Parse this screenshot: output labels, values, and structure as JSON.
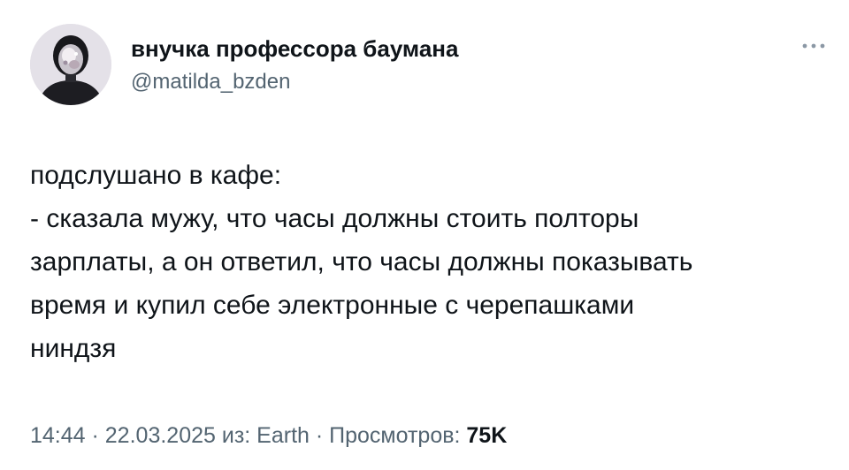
{
  "author": {
    "name": "внучка профессора баумана",
    "handle": "@matilda_bzden"
  },
  "icons": {
    "avatar": "profile-avatar",
    "more": "more-options-icon"
  },
  "tweet": {
    "lines": [
      "подслушано в кафе:",
      "- сказала мужу, что часы должны стоить полторы",
      "зарплаты, а он ответил, что часы должны показывать",
      "время и купил себе электронные с черепашками",
      "ниндзя"
    ]
  },
  "meta": {
    "time": "14:44",
    "separator1": " · ",
    "date": "22.03.2025",
    "source": " из: Earth",
    "separator2": " · ",
    "views_label": "Просмотров: ",
    "views_count": "75K"
  },
  "colors": {
    "text": "#0f1419",
    "secondary": "#536471",
    "background": "#ffffff"
  }
}
